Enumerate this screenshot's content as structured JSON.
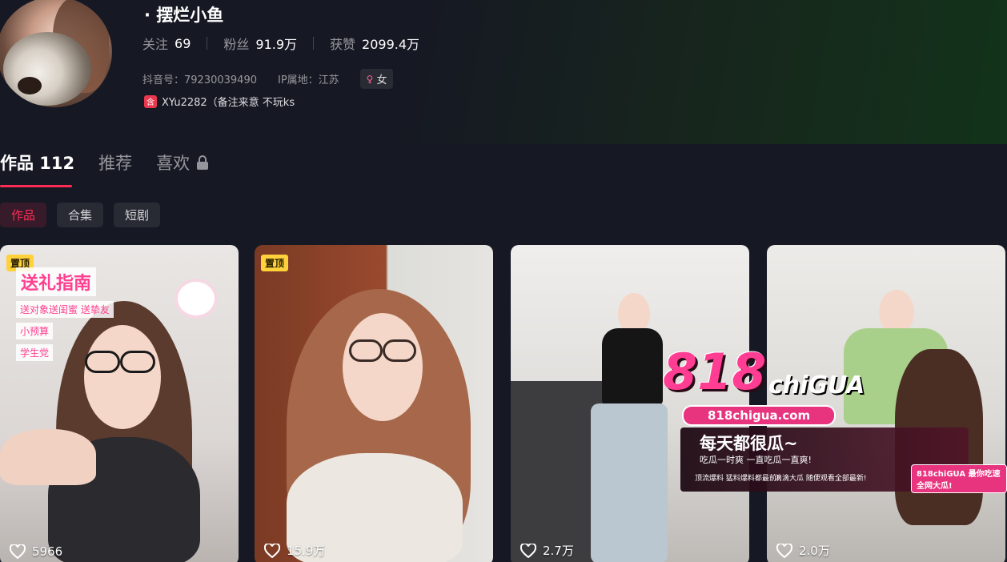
{
  "profile": {
    "username": "· 摆烂小鱼",
    "stats": [
      {
        "label": "关注",
        "value": "69"
      },
      {
        "label": "粉丝",
        "value": "91.9万"
      },
      {
        "label": "获赞",
        "value": "2099.4万"
      }
    ],
    "douyin_id": "抖音号：79230039490",
    "ip_location": "IP属地：江苏",
    "gender": "女",
    "gender_icon": "female-icon",
    "bio_badge": "含",
    "bio": "XYu2282（备注来意 不玩ks"
  },
  "tabs": [
    {
      "label": "作品 112",
      "active": true
    },
    {
      "label": "推荐",
      "active": false
    },
    {
      "label": "喜欢",
      "active": false,
      "icon": "lock-icon"
    }
  ],
  "chips": [
    {
      "label": "作品",
      "active": true
    },
    {
      "label": "合集",
      "active": false
    },
    {
      "label": "短剧",
      "active": false
    }
  ],
  "videos": [
    {
      "pinned": "置顶",
      "likes": "5966",
      "overlay_title": "送礼指南",
      "overlay_lines": [
        "送对象送闺蜜 送挚友",
        "小预算",
        "学生党"
      ]
    },
    {
      "pinned": "置顶",
      "likes": "15.9万"
    },
    {
      "likes": "2.7万"
    },
    {
      "likes": "2.0万"
    }
  ],
  "ad": {
    "logo": "818",
    "logo_suffix": "chiGUA",
    "url": "818chigua.com",
    "slogan": "每天都很瓜~",
    "sub_slogan": "吃瓜一时爽 一直吃瓜一直爽!",
    "item1": "顶流爆料 猛料爆料都最前!",
    "item2": "滴滴大瓜 随便观看全部最新!",
    "tag": "818chiGUA 最你吃速全网大瓜!"
  },
  "colors": {
    "accent": "#fe2c55",
    "background": "#161823",
    "pin": "#ffd13b"
  }
}
